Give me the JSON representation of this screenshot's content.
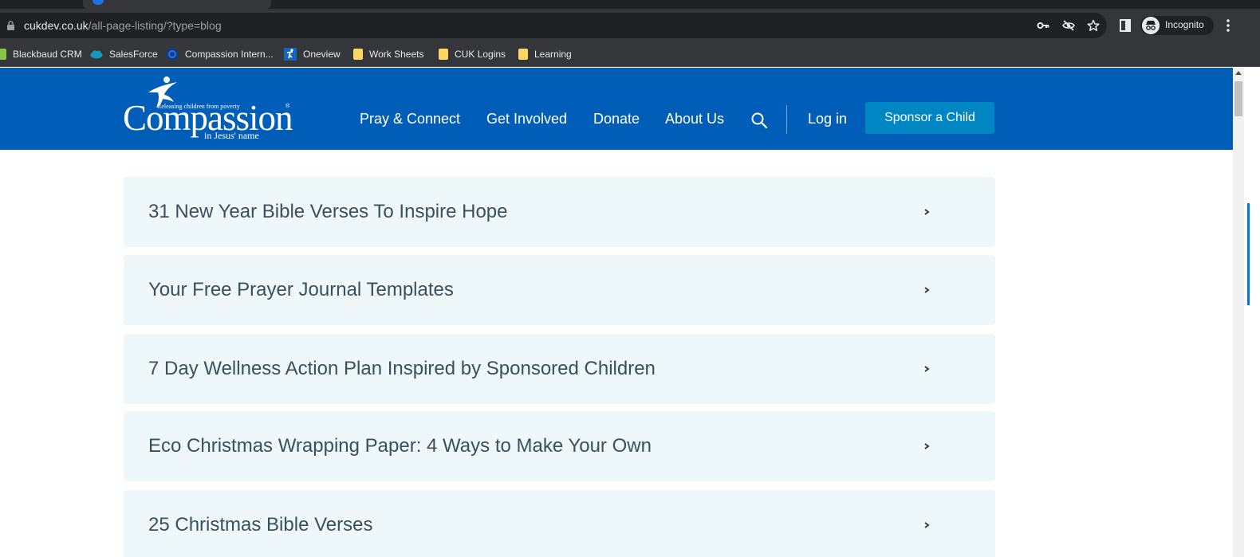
{
  "browser": {
    "url_host": "cukdev.co.uk",
    "url_path": "/all-page-listing/?type=blog",
    "incognito_label": "Incognito",
    "bookmarks": [
      {
        "label": "Blackbaud CRM",
        "icon": "blackbaud-icon",
        "color": "#8bc34a"
      },
      {
        "label": "SalesForce",
        "icon": "salesforce-cloud-icon",
        "color": "#1798c1"
      },
      {
        "label": "Compassion Intern...",
        "icon": "compassion-ring-icon",
        "color": "#0b3d91"
      },
      {
        "label": "Oneview",
        "icon": "compassion-figure-icon",
        "color": "#1565c0"
      },
      {
        "label": "Work Sheets",
        "icon": "folder-icon",
        "color": "#fdd663"
      },
      {
        "label": "CUK Logins",
        "icon": "folder-icon",
        "color": "#fdd663"
      },
      {
        "label": "Learning",
        "icon": "folder-icon",
        "color": "#fdd663"
      }
    ]
  },
  "header": {
    "logo": {
      "tagline": "Releasing children from poverty",
      "wordmark": "Compassion",
      "subline": "in Jesus' name"
    },
    "nav": {
      "pray_connect": "Pray & Connect",
      "get_involved": "Get Involved",
      "donate": "Donate",
      "about_us": "About Us",
      "log_in": "Log in",
      "sponsor": "Sponsor a Child"
    },
    "brand_color": "#005eb8",
    "button_color": "#0086c3"
  },
  "listing": {
    "items": [
      {
        "title": "31 New Year Bible Verses To Inspire Hope"
      },
      {
        "title": "Your Free Prayer Journal Templates"
      },
      {
        "title": "7 Day Wellness Action Plan Inspired by Sponsored Children"
      },
      {
        "title": "Eco Christmas Wrapping Paper: 4 Ways to Make Your Own"
      },
      {
        "title": "25 Christmas Bible Verses"
      }
    ]
  }
}
